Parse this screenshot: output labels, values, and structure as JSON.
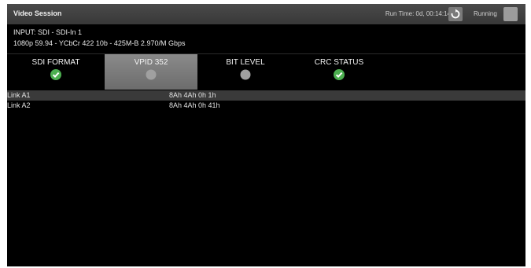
{
  "window": {
    "title": "Video Session",
    "run_time": "Run Time: 0d, 00:14:14",
    "running_label": "Running"
  },
  "input_info": {
    "input": "INPUT: SDI - SDI-In 1",
    "format": "1080p 59.94 - YCbCr 422 10b -  425M-B 2.970/M Gbps"
  },
  "tabs": [
    {
      "label": "SDI FORMAT",
      "status": "pass"
    },
    {
      "label": "VPID 352",
      "status": "inactive"
    },
    {
      "label": "BIT LEVEL",
      "status": "inactive"
    },
    {
      "label": "CRC STATUS",
      "status": "pass"
    }
  ],
  "active_tab": "VPID 352",
  "rows": [
    {
      "name": "Link A1",
      "value": "8Ah 4Ah 0h 1h"
    },
    {
      "name": "Link A2",
      "value": "8Ah 4Ah 0h 41h"
    }
  ],
  "colors": {
    "pass": "#4caf50",
    "inactive": "#a0a0a0",
    "background": "#000000",
    "titlebar": "#404040",
    "selected_row": "#3a3a3a"
  }
}
